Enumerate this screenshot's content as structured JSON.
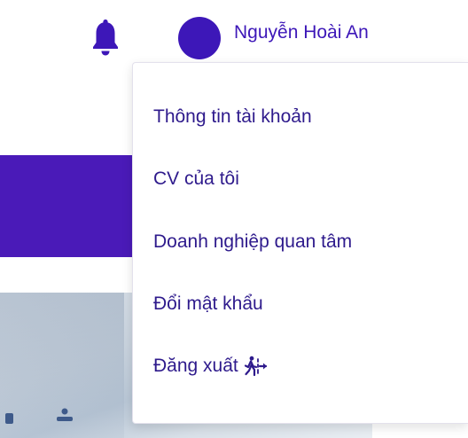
{
  "header": {
    "notification_icon": "bell-icon",
    "user_name": "Nguyễn Hoài An"
  },
  "user_menu": {
    "items": [
      {
        "label": "Thông tin tài khoản"
      },
      {
        "label": "CV của tôi"
      },
      {
        "label": "Doanh nghiệp quan tâm"
      },
      {
        "label": "Đổi mật khẩu"
      },
      {
        "label": "Đăng xuất",
        "icon": "logout-icon"
      }
    ]
  },
  "colors": {
    "brand": "#3d17b8",
    "menu_text": "#2e1a8c",
    "banner": "#4a1ab8"
  }
}
